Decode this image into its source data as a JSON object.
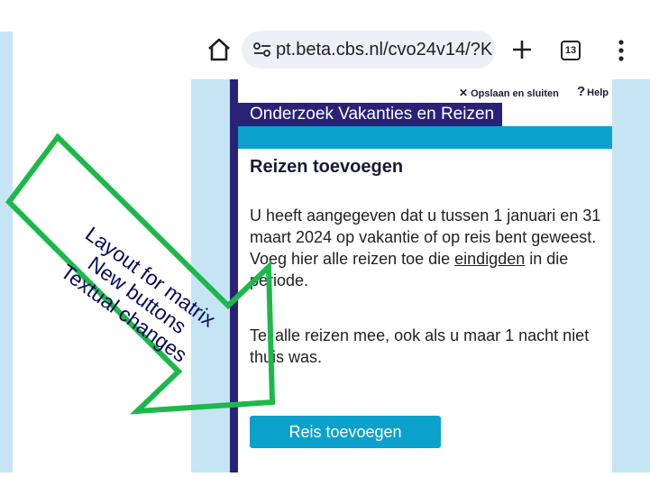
{
  "browser": {
    "url": "pt.beta.cbs.nl/cvo24v14/?K",
    "tab_count": "13",
    "icons": [
      "home-icon",
      "site-settings-icon",
      "new-tab-plus-icon",
      "tab-switcher-icon",
      "more-menu-icon"
    ]
  },
  "survey": {
    "save_close_label": "Opslaan en sluiten",
    "help_label": "Help",
    "title": "Onderzoek Vakanties en Reizen",
    "heading": "Reizen toevoegen",
    "paragraph1_before": "U heeft aangegeven dat u tussen 1 januari en 31 maart 2024 op vakantie of op reis bent geweest. Voeg hier alle reizen toe die ",
    "paragraph1_underlined": "eindigden",
    "paragraph1_after": " in die periode.",
    "paragraph2": "Tel alle reizen mee, ook als u maar 1 nacht niet thuis was.",
    "add_button_label": "Reis toevoegen"
  },
  "annotation": {
    "lines": [
      "Layout for matrix",
      "New buttons",
      "Textual changes"
    ],
    "arrow_color": "#1db84a",
    "text_color": "#0a0a5c"
  },
  "colors": {
    "navy": "#2a2277",
    "cyan": "#0aa1cc",
    "page_background": "#c5e5f5"
  }
}
